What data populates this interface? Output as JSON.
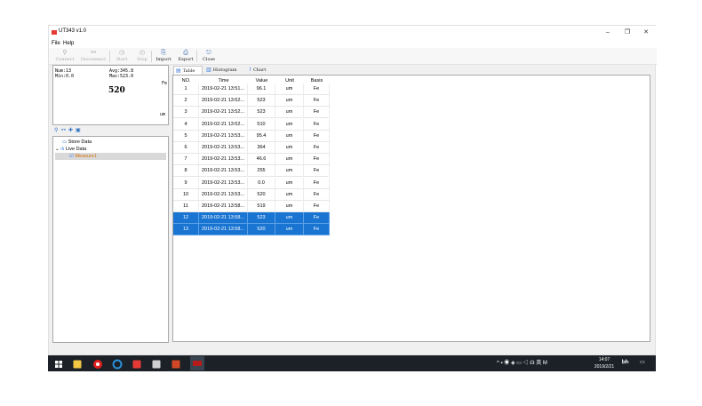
{
  "window": {
    "title": "UT343 v1.0",
    "min_glyph": "–",
    "max_glyph": "❐",
    "close_glyph": "✕"
  },
  "menu": [
    "File",
    "Help"
  ],
  "toolbar": [
    {
      "label": "Connect",
      "icon": "⚲",
      "enabled": false
    },
    {
      "label": "Disconnect",
      "icon": "⚯",
      "enabled": false
    },
    {
      "label": "Start",
      "icon": "◷",
      "enabled": false
    },
    {
      "label": "Stop",
      "icon": "◴",
      "enabled": false
    },
    {
      "label": "Import",
      "icon": "⎘",
      "enabled": true
    },
    {
      "label": "Export",
      "icon": "⎙",
      "enabled": true
    },
    {
      "label": "Close",
      "icon": "⎋",
      "enabled": true
    }
  ],
  "summary": {
    "num": "Num:13",
    "avg": "Avg:345.8",
    "min": "Min:0.0",
    "max": "Max:523.0",
    "basis": "Fe",
    "value": "520",
    "unit": "um"
  },
  "tree_tools": [
    "⚲",
    "⚯",
    "✚",
    "▣"
  ],
  "tree": {
    "store": "Store Data",
    "live": "Live Data",
    "measure": "Measure1",
    "expand_glyph": "⌄"
  },
  "tabs": [
    {
      "label": "Table",
      "icon": "▤"
    },
    {
      "label": "Histogram",
      "icon": "▥"
    },
    {
      "label": "Chart",
      "icon": "⌇"
    }
  ],
  "table": {
    "headers": [
      "NO.",
      "Time",
      "Value",
      "Unit",
      "Basis"
    ],
    "rows": [
      [
        "1",
        "2019-02-21 13:51...",
        "96.1",
        "um",
        "Fe"
      ],
      [
        "2",
        "2019-02-21 13:52...",
        "523",
        "um",
        "Fe"
      ],
      [
        "3",
        "2019-02-21 13:52...",
        "523",
        "um",
        "Fe"
      ],
      [
        "4",
        "2019-02-21 13:52...",
        "510",
        "um",
        "Fe"
      ],
      [
        "5",
        "2019-02-21 13:53...",
        "95.4",
        "um",
        "Fe"
      ],
      [
        "6",
        "2019-02-21 13:53...",
        "364",
        "um",
        "Fe"
      ],
      [
        "7",
        "2019-02-21 13:53...",
        "46.6",
        "um",
        "Fe"
      ],
      [
        "8",
        "2019-02-21 13:53...",
        "255",
        "um",
        "Fe"
      ],
      [
        "9",
        "2019-02-21 13:53...",
        "0.0",
        "um",
        "Fe"
      ],
      [
        "10",
        "2019-02-21 13:53...",
        "520",
        "um",
        "Fe"
      ],
      [
        "11",
        "2019-02-21 13:58...",
        "519",
        "um",
        "Fe"
      ],
      [
        "12",
        "2019-02-21 13:58...",
        "523",
        "um",
        "Fe"
      ],
      [
        "13",
        "2019-02-21 13:58...",
        "520",
        "um",
        "Fe"
      ]
    ],
    "selected": [
      "12",
      "13"
    ]
  },
  "taskbar": {
    "apps": [
      {
        "name": "start-icon",
        "color": "#ffffff"
      },
      {
        "name": "file-explorer-icon",
        "color": "#f2c744"
      },
      {
        "name": "netease-music-icon",
        "color": "#e02020"
      },
      {
        "name": "browser-icon",
        "color": "#2b8fd6"
      },
      {
        "name": "app-red-icon",
        "color": "#e53935"
      },
      {
        "name": "calculator-icon",
        "color": "#d0d0d0"
      },
      {
        "name": "powerpoint-icon",
        "color": "#d24726"
      },
      {
        "name": "ut343-app-icon",
        "color": "#b71c1c"
      }
    ],
    "tray": "^ ▪ ◉ ◈ ▭ ◁ ☊ 英 M",
    "time": "14:07",
    "date": "2019/2/21"
  }
}
